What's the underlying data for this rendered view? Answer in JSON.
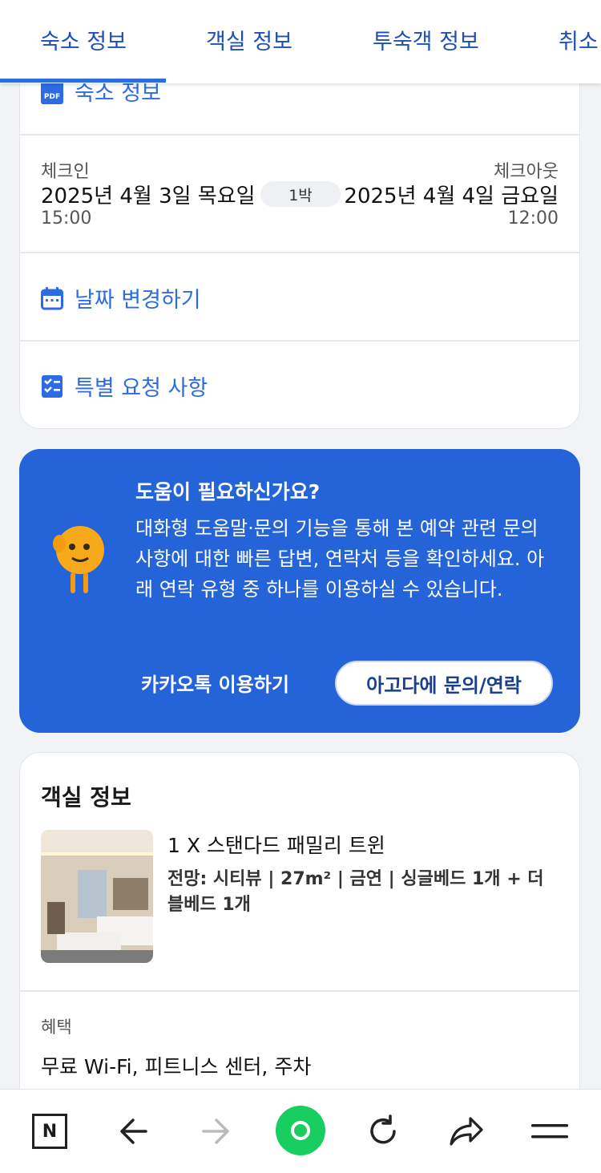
{
  "tabs": [
    {
      "label": "숙소 정보",
      "active": true
    },
    {
      "label": "객실 정보",
      "active": false
    },
    {
      "label": "투숙객 정보",
      "active": false
    },
    {
      "label": "취소",
      "active": false
    }
  ],
  "property_card": {
    "property_info_label": "숙소 정보",
    "checkin_label": "체크인",
    "checkin_date": "2025년 4월 3일 목요일",
    "checkin_time": "15:00",
    "nights": "1박",
    "checkout_label": "체크아웃",
    "checkout_date": "2025년 4월 4일 금요일",
    "checkout_time": "12:00",
    "change_dates": "날짜 변경하기",
    "special_requests": "특별 요청 사항"
  },
  "help_card": {
    "title": "도움이 필요하신가요?",
    "body": "대화형 도움말·문의 기능을 통해 본 예약 관련 문의 사항에 대한 빠른 답변, 연락처 등을 확인하세요. 아래 연락 유형 중 하나를 이용하실 수 있습니다.",
    "kakao_label": "카카오톡 이용하기",
    "agoda_label": "아고다에 문의/연락"
  },
  "room_card": {
    "heading": "객실 정보",
    "room_name": "1 X 스탠다드 패밀리 트윈",
    "room_detail": "전망: 시티뷰 | 27m² | 금연 | 싱글베드 1개 + 더블베드 1개",
    "benefit_label": "혜택",
    "benefit_text": "무료 Wi-Fi, 피트니스 센터, 주차"
  },
  "bottom_bar": {
    "icons": [
      "naver-n-icon",
      "back-arrow-icon",
      "forward-arrow-icon",
      "green-home-icon",
      "refresh-icon",
      "share-icon",
      "menu-icon"
    ],
    "n_label": "N"
  },
  "colors": {
    "accent": "#2d6be4",
    "tab_text": "#1c4fb8",
    "help_bg": "#2563d9",
    "green": "#19ce60"
  }
}
